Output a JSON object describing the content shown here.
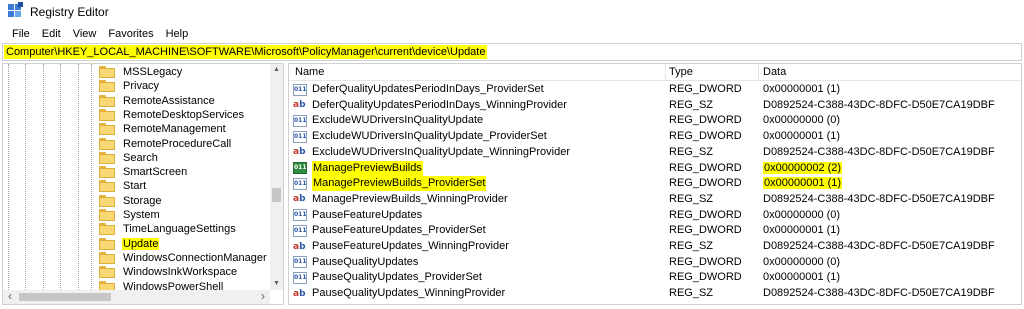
{
  "window": {
    "title": "Registry Editor"
  },
  "menu": [
    "File",
    "Edit",
    "View",
    "Favorites",
    "Help"
  ],
  "address": "Computer\\HKEY_LOCAL_MACHINE\\SOFTWARE\\Microsoft\\PolicyManager\\current\\device\\Update",
  "tree": {
    "items": [
      {
        "label": "MSSLegacy",
        "highlighted": false
      },
      {
        "label": "Privacy",
        "highlighted": false
      },
      {
        "label": "RemoteAssistance",
        "highlighted": false
      },
      {
        "label": "RemoteDesktopServices",
        "highlighted": false
      },
      {
        "label": "RemoteManagement",
        "highlighted": false
      },
      {
        "label": "RemoteProcedureCall",
        "highlighted": false
      },
      {
        "label": "Search",
        "highlighted": false
      },
      {
        "label": "SmartScreen",
        "highlighted": false
      },
      {
        "label": "Start",
        "highlighted": false
      },
      {
        "label": "Storage",
        "highlighted": false
      },
      {
        "label": "System",
        "highlighted": false
      },
      {
        "label": "TimeLanguageSettings",
        "highlighted": false
      },
      {
        "label": "Update",
        "highlighted": true
      },
      {
        "label": "WindowsConnectionManager",
        "highlighted": false
      },
      {
        "label": "WindowsInkWorkspace",
        "highlighted": false
      },
      {
        "label": "WindowsPowerShell",
        "highlighted": false
      }
    ]
  },
  "list": {
    "columns": {
      "name": "Name",
      "type": "Type",
      "data": "Data"
    },
    "rows": [
      {
        "name": "DeferQualityUpdatesPeriodInDays_ProviderSet",
        "type": "REG_DWORD",
        "data": "0x00000001 (1)",
        "icon": "dword",
        "name_hl": false,
        "data_hl": false
      },
      {
        "name": "DeferQualityUpdatesPeriodInDays_WinningProvider",
        "type": "REG_SZ",
        "data": "D0892524-C388-43DC-8DFC-D50E7CA19DBF",
        "icon": "sz",
        "name_hl": false,
        "data_hl": false
      },
      {
        "name": "ExcludeWUDriversInQualityUpdate",
        "type": "REG_DWORD",
        "data": "0x00000000 (0)",
        "icon": "dword",
        "name_hl": false,
        "data_hl": false
      },
      {
        "name": "ExcludeWUDriversInQualityUpdate_ProviderSet",
        "type": "REG_DWORD",
        "data": "0x00000001 (1)",
        "icon": "dword",
        "name_hl": false,
        "data_hl": false
      },
      {
        "name": "ExcludeWUDriversInQualityUpdate_WinningProvider",
        "type": "REG_SZ",
        "data": "D0892524-C388-43DC-8DFC-D50E7CA19DBF",
        "icon": "sz",
        "name_hl": false,
        "data_hl": false
      },
      {
        "name": "ManagePreviewBuilds",
        "type": "REG_DWORD",
        "data": "0x00000002 (2)",
        "icon": "dword-selected",
        "name_hl": true,
        "data_hl": true
      },
      {
        "name": "ManagePreviewBuilds_ProviderSet",
        "type": "REG_DWORD",
        "data": "0x00000001 (1)",
        "icon": "dword",
        "name_hl": true,
        "data_hl": true
      },
      {
        "name": "ManagePreviewBuilds_WinningProvider",
        "type": "REG_SZ",
        "data": "D0892524-C388-43DC-8DFC-D50E7CA19DBF",
        "icon": "sz",
        "name_hl": false,
        "data_hl": false
      },
      {
        "name": "PauseFeatureUpdates",
        "type": "REG_DWORD",
        "data": "0x00000000 (0)",
        "icon": "dword",
        "name_hl": false,
        "data_hl": false
      },
      {
        "name": "PauseFeatureUpdates_ProviderSet",
        "type": "REG_DWORD",
        "data": "0x00000001 (1)",
        "icon": "dword",
        "name_hl": false,
        "data_hl": false
      },
      {
        "name": "PauseFeatureUpdates_WinningProvider",
        "type": "REG_SZ",
        "data": "D0892524-C388-43DC-8DFC-D50E7CA19DBF",
        "icon": "sz",
        "name_hl": false,
        "data_hl": false
      },
      {
        "name": "PauseQualityUpdates",
        "type": "REG_DWORD",
        "data": "0x00000000 (0)",
        "icon": "dword",
        "name_hl": false,
        "data_hl": false
      },
      {
        "name": "PauseQualityUpdates_ProviderSet",
        "type": "REG_DWORD",
        "data": "0x00000001 (1)",
        "icon": "dword",
        "name_hl": false,
        "data_hl": false
      },
      {
        "name": "PauseQualityUpdates_WinningProvider",
        "type": "REG_SZ",
        "data": "D0892524-C388-43DC-8DFC-D50E7CA19DBF",
        "icon": "sz",
        "name_hl": false,
        "data_hl": false
      }
    ]
  },
  "icons": {
    "app": "registry-editor-icon",
    "folder": "folder-icon",
    "dword": "binary-value-icon",
    "sz": "string-value-icon"
  },
  "colors": {
    "highlight": "#ffff00",
    "selected_icon": "#2f8b3d"
  }
}
